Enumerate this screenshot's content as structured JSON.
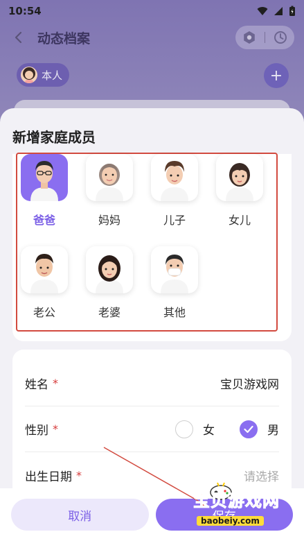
{
  "status": {
    "time": "10:54"
  },
  "header": {
    "title": "动态档案"
  },
  "self_chip": {
    "label": "本人"
  },
  "add_button": {
    "label": "+"
  },
  "sheet": {
    "title": "新增家庭成员",
    "members": [
      {
        "label": "爸爸",
        "selected": true
      },
      {
        "label": "妈妈",
        "selected": false
      },
      {
        "label": "儿子",
        "selected": false
      },
      {
        "label": "女儿",
        "selected": false
      },
      {
        "label": "老公",
        "selected": false
      },
      {
        "label": "老婆",
        "selected": false
      },
      {
        "label": "其他",
        "selected": false
      }
    ]
  },
  "form": {
    "name_label": "姓名",
    "name_value": "宝贝游戏网",
    "gender_label": "性别",
    "gender_female": "女",
    "gender_male": "男",
    "gender_selected": "男",
    "birth_label": "出生日期",
    "birth_placeholder": "请选择",
    "required_mark": "*"
  },
  "actions": {
    "cancel_label": "取消",
    "save_label": "保存"
  },
  "watermark": {
    "text": "宝贝游戏网",
    "url": "baobeiy.com"
  },
  "colors": {
    "accent": "#8a6ef0",
    "annotation": "#d24a3f",
    "required": "#d63b3b"
  }
}
